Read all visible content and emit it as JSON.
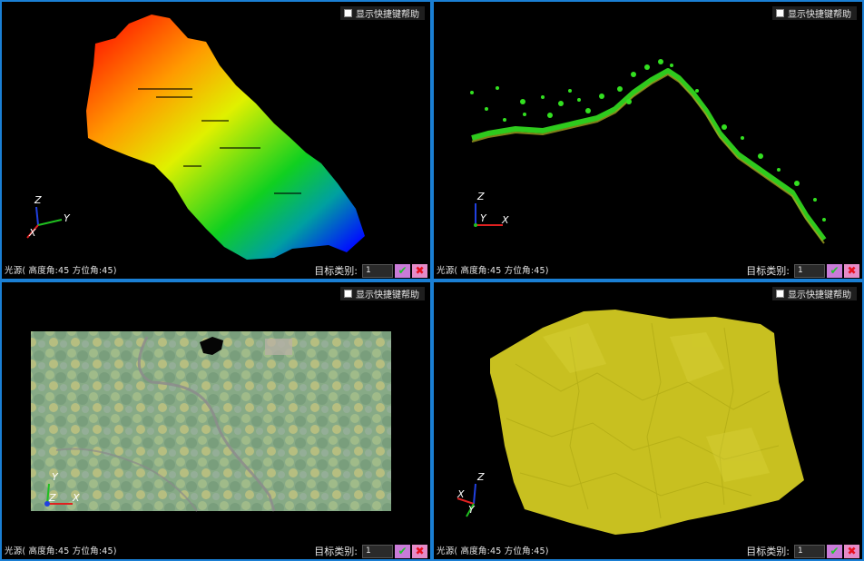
{
  "viewports": {
    "tl": {
      "help_label": "显示快捷键帮助",
      "light_info": "光源( 高度角:45 方位角:45)",
      "target_label": "目标类别:",
      "target_value": "1"
    },
    "tr": {
      "help_label": "显示快捷键帮助",
      "light_info": "光源( 高度角:45 方位角:45)",
      "target_label": "目标类别:",
      "target_value": "1"
    },
    "bl": {
      "help_label": "显示快捷键帮助",
      "light_info": "光源( 高度角:45 方位角:45)",
      "target_label": "目标类别:",
      "target_value": "1"
    },
    "br": {
      "help_label": "显示快捷键帮助",
      "light_info": "光源( 高度角:45 方位角:45)",
      "target_label": "目标类别:",
      "target_value": "1"
    }
  },
  "axes": {
    "x": "X",
    "y": "Y",
    "z": "Z"
  },
  "buttons": {
    "confirm_icon": "✔",
    "cancel_icon": "✖"
  },
  "colors": {
    "border": "#1a7fd4",
    "axis_x": "#e02020",
    "axis_y": "#20c020",
    "axis_z": "#2040e0",
    "mesh": "#c8c020",
    "profile": "#33e020"
  }
}
